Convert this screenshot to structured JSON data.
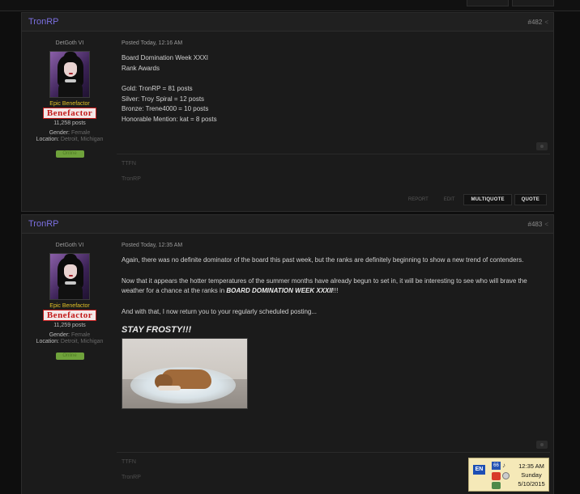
{
  "posts": [
    {
      "username": "TronRP",
      "post_number": "#482",
      "user_title": "DetGoth VI",
      "rank_text": "Epic Benefactor",
      "rank_badge": "Benefactor",
      "post_count": "11,258 posts",
      "gender_label": "Gender:",
      "gender_value": "Female",
      "location_label": "Location:",
      "location_value": "Detroit, Michigan",
      "online_badge": "Online",
      "posted": "Posted Today, 12:16 AM",
      "lines": [
        "Board Domination Week XXXI",
        "Rank Awards",
        "",
        "Gold: TronRP = 81 posts",
        "Silver: Troy Spiral = 12 posts",
        "Bronze: Trene4000 = 10 posts",
        "Honorable Mention: kat = 8 posts"
      ],
      "signature": [
        "TTFN",
        "TronRP"
      ],
      "actions": {
        "report": "REPORT",
        "edit": "EDIT",
        "multiquote": "MULTIQUOTE",
        "quote": "QUOTE"
      }
    },
    {
      "username": "TronRP",
      "post_number": "#483",
      "user_title": "DetGoth VI",
      "rank_text": "Epic Benefactor",
      "rank_badge": "Benefactor",
      "post_count": "11,259 posts",
      "gender_label": "Gender:",
      "gender_value": "Female",
      "location_label": "Location:",
      "location_value": "Detroit, Michigan",
      "online_badge": "Online",
      "posted": "Posted Today, 12:35 AM",
      "para1": "Again, there was no definite dominator of the board this past week, but the ranks are definitely beginning to show a new trend of contenders.",
      "para2_a": "Now that it appears the hotter temperatures of the summer months have already begun to set in, it will be interesting to see who will brave the weather for a chance at the ranks in ",
      "para2_emph": "BOARD DOMINATION WEEK XXXII",
      "para2_b": "!!!",
      "para3": "And with that, I now return you to your regularly scheduled posting...",
      "big_text": "STAY FROSTY!!!",
      "image_icon": "dog-on-ice-image",
      "signature": [
        "TTFN",
        "TronRP"
      ]
    }
  ],
  "tray": {
    "lang": "EN",
    "time": "12:35 AM",
    "day": "Sunday",
    "date": "5/10/2015"
  }
}
